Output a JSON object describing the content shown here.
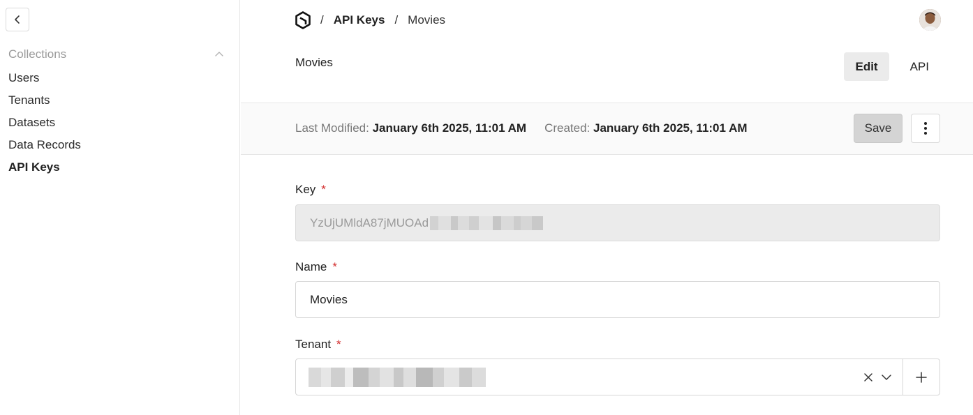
{
  "sidebar": {
    "collections_title": "Collections",
    "items": [
      {
        "label": "Users",
        "active": false
      },
      {
        "label": "Tenants",
        "active": false
      },
      {
        "label": "Datasets",
        "active": false
      },
      {
        "label": "Data Records",
        "active": false
      },
      {
        "label": "API Keys",
        "active": true
      }
    ]
  },
  "breadcrumb": {
    "separator": "/",
    "collection": "API Keys",
    "document": "Movies"
  },
  "document": {
    "title": "Movies"
  },
  "tabs": {
    "edit_label": "Edit",
    "api_label": "API"
  },
  "meta": {
    "last_modified_label": "Last Modified:",
    "last_modified_value": "January 6th 2025, 11:01 AM",
    "created_label": "Created:",
    "created_value": "January 6th 2025, 11:01 AM",
    "save_label": "Save"
  },
  "form": {
    "key": {
      "label": "Key",
      "required_mark": "*",
      "value_visible": "YzUjUMldA87jMUOAd"
    },
    "name": {
      "label": "Name",
      "required_mark": "*",
      "value": "Movies"
    },
    "tenant": {
      "label": "Tenant",
      "required_mark": "*"
    }
  },
  "icons": {
    "back": "chevron-left-icon",
    "collapse": "chevron-up-icon",
    "logo": "payload-logo-icon",
    "more": "vertical-dots-icon",
    "clear": "close-icon",
    "dropdown": "chevron-down-icon",
    "add": "plus-icon"
  },
  "colors": {
    "required": "#d32f2f",
    "active_tab_bg": "#ebebeb",
    "save_bg": "#d4d4d4",
    "readonly_bg": "#ebebeb"
  }
}
